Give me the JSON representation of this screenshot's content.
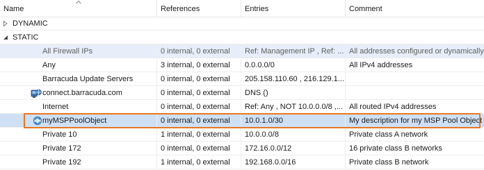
{
  "columns": {
    "name": "Name",
    "references": "References",
    "entries": "Entries",
    "comment": "Comment"
  },
  "groups": {
    "dynamic": "DYNAMIC",
    "static": "STATIC"
  },
  "rows": [
    {
      "name": "All Firewall IPs",
      "references": "0 internal,  0 external",
      "entries": "Ref: Management IP , Ref: ...",
      "comment": "All addresses configured or dynamically..."
    },
    {
      "name": "Any",
      "references": "3 internal,  0 external",
      "entries": "0.0.0.0/0",
      "comment": "All IPv4 addresses"
    },
    {
      "name": "Barracuda Update Servers",
      "references": "0 internal,  0 external",
      "entries": "205.158.110.60 , 216.129.1...",
      "comment": ""
    },
    {
      "name": "connect.barracuda.com",
      "references": "0 internal,  0 external",
      "entries": "DNS ()",
      "comment": ""
    },
    {
      "name": "Internet",
      "references": "0 internal,  0 external",
      "entries": "Ref: Any , NOT 10.0.0.0/8 ,...",
      "comment": "All routed IPv4 addresses"
    },
    {
      "name": "myMSPPoolObject",
      "references": "0 internal,  0 external",
      "entries": "10.0.1.0/30",
      "comment": "My description for my MSP Pool Object"
    },
    {
      "name": "Private 10",
      "references": "1 internal,  0 external",
      "entries": "10.0.0.0/8",
      "comment": "Private class A network"
    },
    {
      "name": "Private 172",
      "references": "0 internal,  0 external",
      "entries": "172.16.0.0/12",
      "comment": "16 private class B networks"
    },
    {
      "name": "Private 192",
      "references": "1 internal,  0 external",
      "entries": "192.168.0.0/16",
      "comment": "Private class B network"
    }
  ],
  "colors": {
    "highlight_border": "#e87722",
    "selected_row": "#cfe0f5",
    "alt_selected_row": "#e7eef9"
  },
  "icons": {
    "sort": "sort-up-arrow-icon",
    "collapsed": "triangle-right-icon",
    "expanded": "triangle-down-icon",
    "network_object": "network-computer-icon",
    "pool": "sync-pool-icon"
  }
}
